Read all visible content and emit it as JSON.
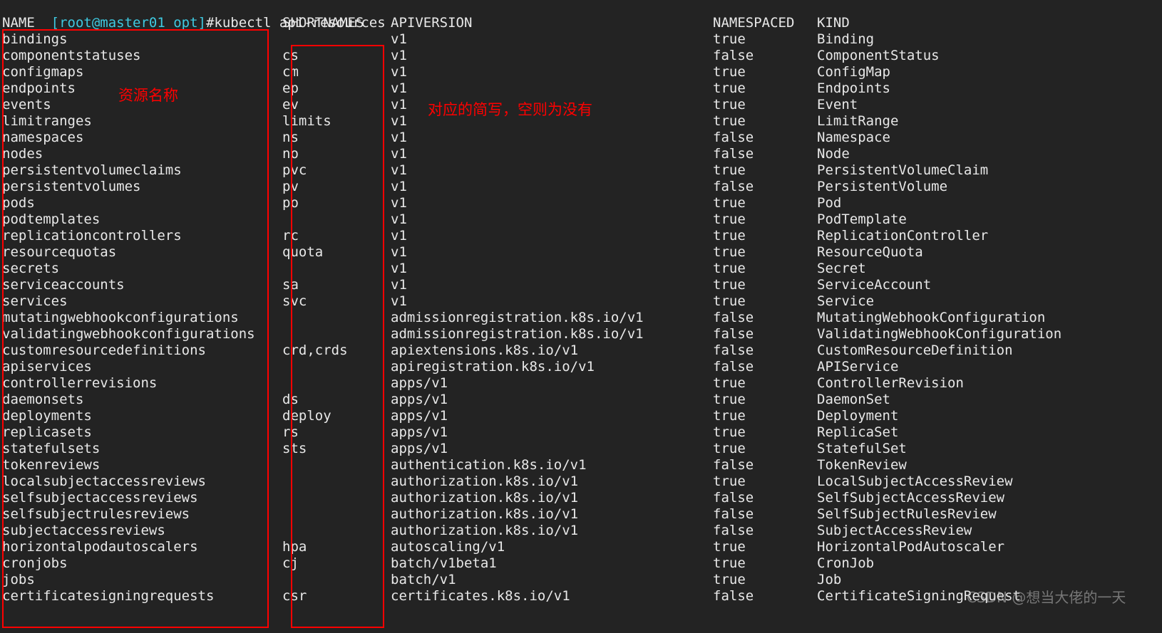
{
  "terminal": {
    "prompt": "[root@master01 opt]",
    "command": "#kubectl api-resources",
    "background_color": "#232323",
    "text_color": "#e8e8e8",
    "prompt_color": "#3fc9e0"
  },
  "table": {
    "headers": {
      "name": "NAME",
      "shortnames": "SHORTNAMES",
      "apiversion": "APIVERSION",
      "namespaced": "NAMESPACED",
      "kind": "KIND"
    },
    "rows": [
      {
        "name": "bindings",
        "shortnames": "",
        "apiversion": "v1",
        "namespaced": "true",
        "kind": "Binding"
      },
      {
        "name": "componentstatuses",
        "shortnames": "cs",
        "apiversion": "v1",
        "namespaced": "false",
        "kind": "ComponentStatus"
      },
      {
        "name": "configmaps",
        "shortnames": "cm",
        "apiversion": "v1",
        "namespaced": "true",
        "kind": "ConfigMap"
      },
      {
        "name": "endpoints",
        "shortnames": "ep",
        "apiversion": "v1",
        "namespaced": "true",
        "kind": "Endpoints"
      },
      {
        "name": "events",
        "shortnames": "ev",
        "apiversion": "v1",
        "namespaced": "true",
        "kind": "Event"
      },
      {
        "name": "limitranges",
        "shortnames": "limits",
        "apiversion": "v1",
        "namespaced": "true",
        "kind": "LimitRange"
      },
      {
        "name": "namespaces",
        "shortnames": "ns",
        "apiversion": "v1",
        "namespaced": "false",
        "kind": "Namespace"
      },
      {
        "name": "nodes",
        "shortnames": "no",
        "apiversion": "v1",
        "namespaced": "false",
        "kind": "Node"
      },
      {
        "name": "persistentvolumeclaims",
        "shortnames": "pvc",
        "apiversion": "v1",
        "namespaced": "true",
        "kind": "PersistentVolumeClaim"
      },
      {
        "name": "persistentvolumes",
        "shortnames": "pv",
        "apiversion": "v1",
        "namespaced": "false",
        "kind": "PersistentVolume"
      },
      {
        "name": "pods",
        "shortnames": "po",
        "apiversion": "v1",
        "namespaced": "true",
        "kind": "Pod"
      },
      {
        "name": "podtemplates",
        "shortnames": "",
        "apiversion": "v1",
        "namespaced": "true",
        "kind": "PodTemplate"
      },
      {
        "name": "replicationcontrollers",
        "shortnames": "rc",
        "apiversion": "v1",
        "namespaced": "true",
        "kind": "ReplicationController"
      },
      {
        "name": "resourcequotas",
        "shortnames": "quota",
        "apiversion": "v1",
        "namespaced": "true",
        "kind": "ResourceQuota"
      },
      {
        "name": "secrets",
        "shortnames": "",
        "apiversion": "v1",
        "namespaced": "true",
        "kind": "Secret"
      },
      {
        "name": "serviceaccounts",
        "shortnames": "sa",
        "apiversion": "v1",
        "namespaced": "true",
        "kind": "ServiceAccount"
      },
      {
        "name": "services",
        "shortnames": "svc",
        "apiversion": "v1",
        "namespaced": "true",
        "kind": "Service"
      },
      {
        "name": "mutatingwebhookconfigurations",
        "shortnames": "",
        "apiversion": "admissionregistration.k8s.io/v1",
        "namespaced": "false",
        "kind": "MutatingWebhookConfiguration"
      },
      {
        "name": "validatingwebhookconfigurations",
        "shortnames": "",
        "apiversion": "admissionregistration.k8s.io/v1",
        "namespaced": "false",
        "kind": "ValidatingWebhookConfiguration"
      },
      {
        "name": "customresourcedefinitions",
        "shortnames": "crd,crds",
        "apiversion": "apiextensions.k8s.io/v1",
        "namespaced": "false",
        "kind": "CustomResourceDefinition"
      },
      {
        "name": "apiservices",
        "shortnames": "",
        "apiversion": "apiregistration.k8s.io/v1",
        "namespaced": "false",
        "kind": "APIService"
      },
      {
        "name": "controllerrevisions",
        "shortnames": "",
        "apiversion": "apps/v1",
        "namespaced": "true",
        "kind": "ControllerRevision"
      },
      {
        "name": "daemonsets",
        "shortnames": "ds",
        "apiversion": "apps/v1",
        "namespaced": "true",
        "kind": "DaemonSet"
      },
      {
        "name": "deployments",
        "shortnames": "deploy",
        "apiversion": "apps/v1",
        "namespaced": "true",
        "kind": "Deployment"
      },
      {
        "name": "replicasets",
        "shortnames": "rs",
        "apiversion": "apps/v1",
        "namespaced": "true",
        "kind": "ReplicaSet"
      },
      {
        "name": "statefulsets",
        "shortnames": "sts",
        "apiversion": "apps/v1",
        "namespaced": "true",
        "kind": "StatefulSet"
      },
      {
        "name": "tokenreviews",
        "shortnames": "",
        "apiversion": "authentication.k8s.io/v1",
        "namespaced": "false",
        "kind": "TokenReview"
      },
      {
        "name": "localsubjectaccessreviews",
        "shortnames": "",
        "apiversion": "authorization.k8s.io/v1",
        "namespaced": "true",
        "kind": "LocalSubjectAccessReview"
      },
      {
        "name": "selfsubjectaccessreviews",
        "shortnames": "",
        "apiversion": "authorization.k8s.io/v1",
        "namespaced": "false",
        "kind": "SelfSubjectAccessReview"
      },
      {
        "name": "selfsubjectrulesreviews",
        "shortnames": "",
        "apiversion": "authorization.k8s.io/v1",
        "namespaced": "false",
        "kind": "SelfSubjectRulesReview"
      },
      {
        "name": "subjectaccessreviews",
        "shortnames": "",
        "apiversion": "authorization.k8s.io/v1",
        "namespaced": "false",
        "kind": "SubjectAccessReview"
      },
      {
        "name": "horizontalpodautoscalers",
        "shortnames": "hpa",
        "apiversion": "autoscaling/v1",
        "namespaced": "true",
        "kind": "HorizontalPodAutoscaler"
      },
      {
        "name": "cronjobs",
        "shortnames": "cj",
        "apiversion": "batch/v1beta1",
        "namespaced": "true",
        "kind": "CronJob"
      },
      {
        "name": "jobs",
        "shortnames": "",
        "apiversion": "batch/v1",
        "namespaced": "true",
        "kind": "Job"
      },
      {
        "name": "certificatesigningrequests",
        "shortnames": "csr",
        "apiversion": "certificates.k8s.io/v1",
        "namespaced": "false",
        "kind": "CertificateSigningRequest"
      }
    ]
  },
  "annotations": {
    "color": "#ff0000",
    "name_column_note": "资源名称",
    "shortnames_column_note": "对应的简写，空则为没有"
  },
  "watermark": {
    "text": "CSDN @想当大佬的一天"
  }
}
